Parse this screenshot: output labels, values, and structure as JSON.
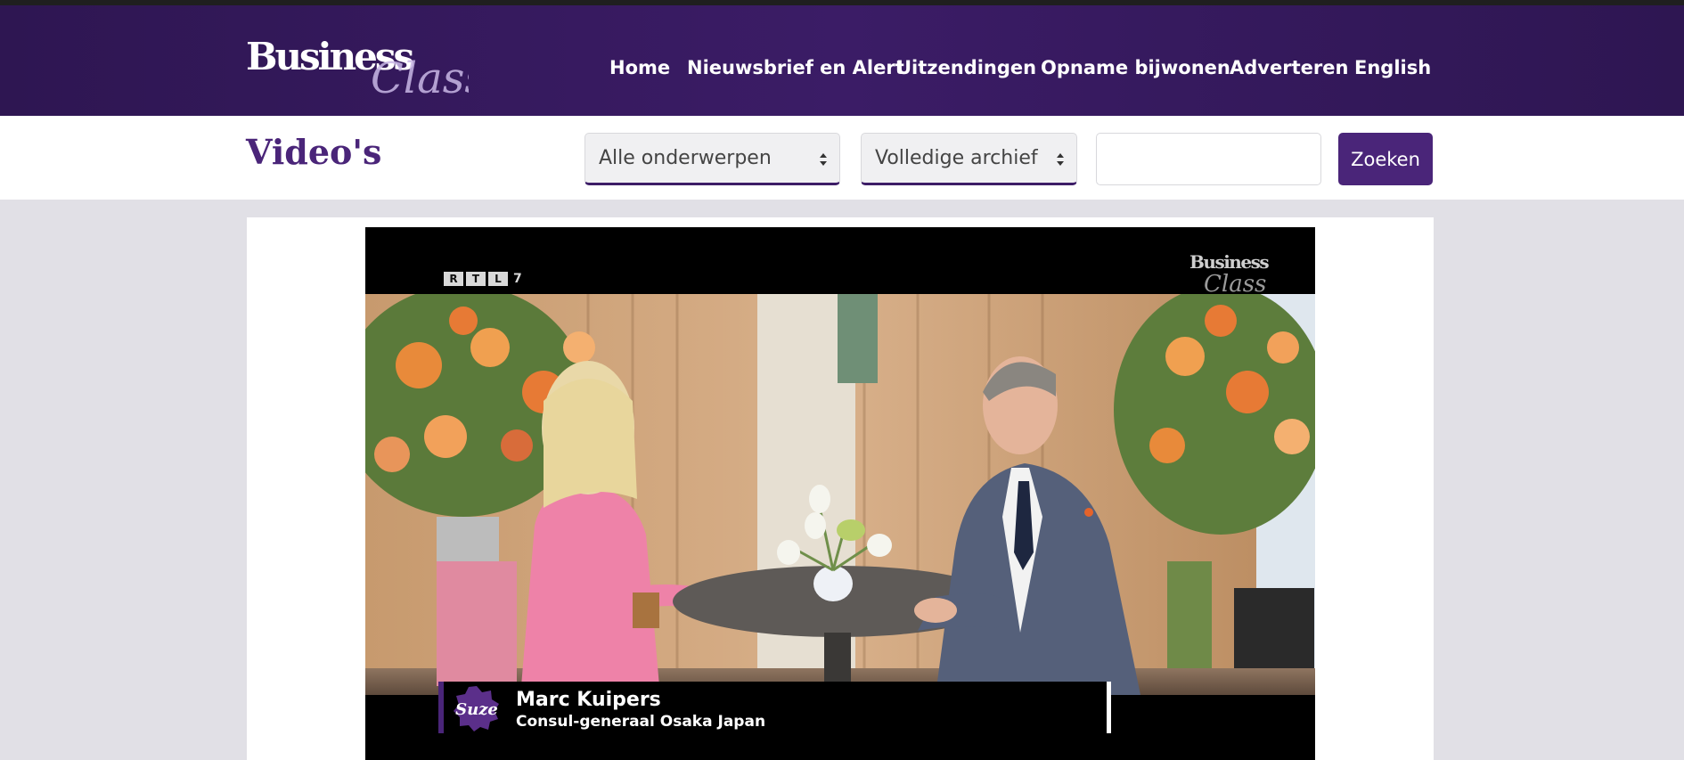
{
  "header": {
    "logo_text": "BusinessClass",
    "nav": [
      {
        "label": "Home"
      },
      {
        "label": "Nieuwsbrief en Alert"
      },
      {
        "label": "Uitzendingen"
      },
      {
        "label": "Opname bijwonen"
      },
      {
        "label": "Adverteren"
      },
      {
        "label": "English"
      }
    ]
  },
  "toolbar": {
    "title": "Video's",
    "topic_select": "Alle onderwerpen",
    "archive_select": "Volledige archief",
    "search_value": "",
    "search_button": "Zoeken"
  },
  "video": {
    "channel_logo": "RTL 7",
    "channel_letters": [
      "R",
      "T",
      "L"
    ],
    "channel_number": "7",
    "watermark_text": "BusinessClass",
    "lower_third": {
      "badge_text": "Suze",
      "name": "Marc Kuipers",
      "role": "Consul-generaal Osaka Japan"
    }
  },
  "colors": {
    "brand_purple": "#4a2579",
    "header_bg": "#2e1652",
    "page_bg": "#e1e0e6"
  }
}
